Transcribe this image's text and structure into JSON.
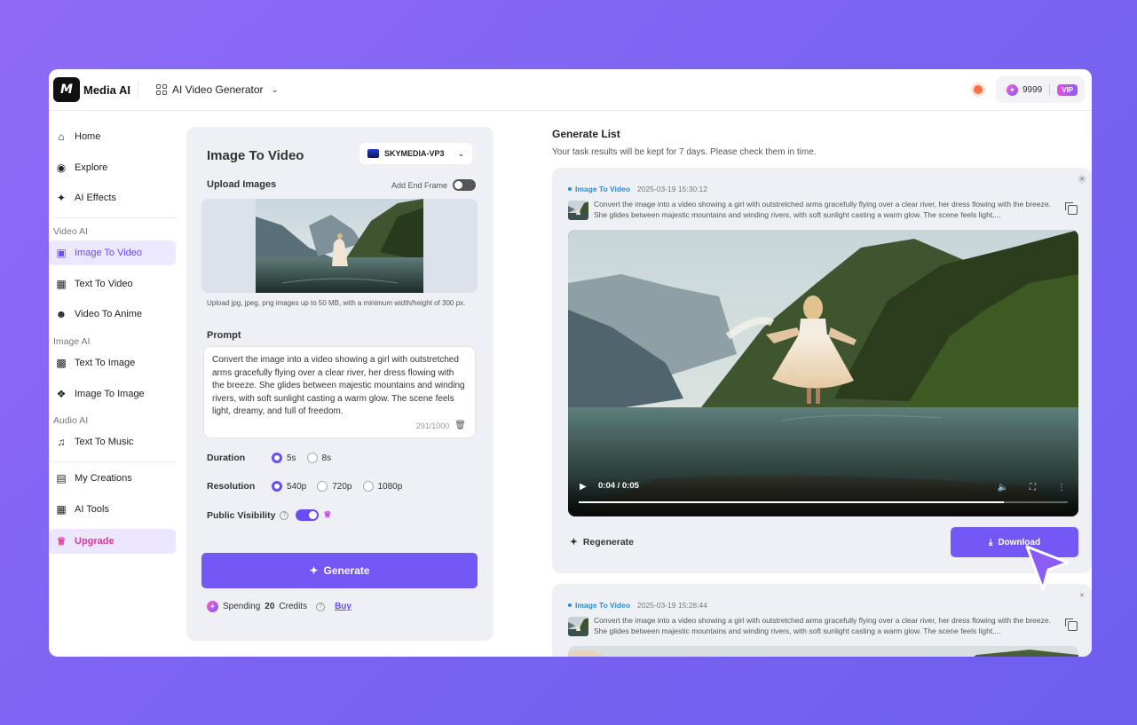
{
  "app": {
    "logo_mark": "M",
    "name": "Media AI",
    "tool_selector": "AI Video Generator"
  },
  "account": {
    "credits": "9999",
    "badge": "VIP"
  },
  "sidebar": {
    "items": [
      {
        "label": "Home",
        "icon": "home-icon"
      },
      {
        "label": "Explore",
        "icon": "compass-icon"
      },
      {
        "label": "AI Effects",
        "icon": "sparkle-icon"
      }
    ],
    "video_section": "Video AI",
    "video_items": [
      {
        "label": "Image To Video",
        "icon": "image-video-icon",
        "active": true
      },
      {
        "label": "Text To Video",
        "icon": "text-video-icon"
      },
      {
        "label": "Video To Anime",
        "icon": "anime-icon"
      }
    ],
    "image_section": "Image AI",
    "image_items": [
      {
        "label": "Text To Image",
        "icon": "text-image-icon"
      },
      {
        "label": "Image To Image",
        "icon": "image-image-icon"
      }
    ],
    "audio_section": "Audio AI",
    "audio_items": [
      {
        "label": "Text To Music",
        "icon": "music-icon"
      }
    ],
    "bottom_items": [
      {
        "label": "My Creations",
        "icon": "creations-icon"
      },
      {
        "label": "AI Tools",
        "icon": "tools-icon"
      }
    ],
    "upgrade": "Upgrade"
  },
  "form": {
    "title": "Image To Video",
    "model": "SKYMEDIA-VP3",
    "upload_label": "Upload Images",
    "add_end_frame": "Add End Frame",
    "upload_hint": "Upload jpg, jpeg, png images up to 50 MB, with a minimum width/height of 300 px.",
    "prompt_label": "Prompt",
    "prompt_text": "Convert the image into a video showing a girl with outstretched arms gracefully flying over a clear river, her dress flowing with the breeze. She glides between majestic mountains and winding rivers, with soft sunlight casting a warm glow. The scene feels light, dreamy, and full of freedom.",
    "prompt_count": "291/1000",
    "duration_label": "Duration",
    "duration_options": [
      "5s",
      "8s"
    ],
    "duration_selected": "5s",
    "resolution_label": "Resolution",
    "resolution_options": [
      "540p",
      "720p",
      "1080p"
    ],
    "resolution_selected": "540p",
    "visibility_label": "Public Visibility",
    "visibility_on": true,
    "generate_label": "Generate",
    "spending_prefix": "Spending",
    "spending_credits": "20",
    "spending_suffix": "Credits",
    "buy_label": "Buy"
  },
  "generate_list": {
    "title": "Generate List",
    "subtitle": "Your task results will be kept for 7 days. Please check them in time.",
    "tasks": [
      {
        "type": "Image To Video",
        "date": "2025-03-19 15:30:12",
        "text": "Convert the image into a video showing a girl with outstretched arms gracefully flying over a clear river, her dress flowing with the breeze. She glides between majestic mountains and winding rivers, with soft sunlight casting a warm glow. The scene feels light,...",
        "video_time": "0:04 / 0:05",
        "progress": 0.87,
        "regenerate_label": "Regenerate",
        "download_label": "Download"
      },
      {
        "type": "Image To Video",
        "date": "2025-03-19 15:28:44",
        "text": "Convert the image into a video showing a girl with outstretched arms gracefully flying over a clear river, her dress flowing with the breeze. She glides between majestic mountains and winding rivers, with soft sunlight casting a warm glow. The scene feels light,..."
      }
    ]
  },
  "colors": {
    "accent": "#7358f5",
    "background_gradient": "#8f6bf7",
    "task_tag": "#1f8fe0"
  }
}
